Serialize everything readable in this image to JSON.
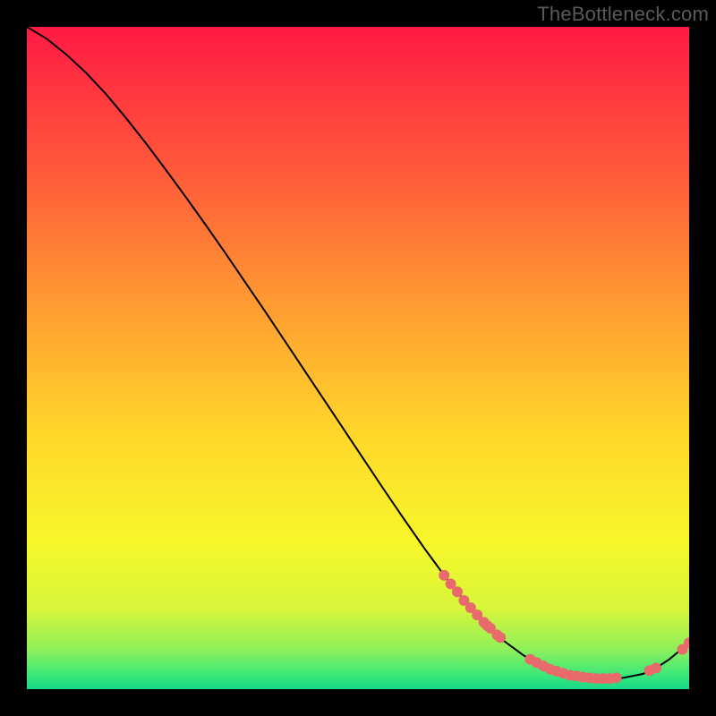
{
  "watermark": "TheBottleneck.com",
  "chart_data": {
    "type": "line",
    "title": "",
    "xlabel": "",
    "ylabel": "",
    "xlim": [
      0,
      100
    ],
    "ylim": [
      0,
      100
    ],
    "curve": {
      "name": "bottleneck-curve",
      "x": [
        0,
        3,
        6,
        9,
        12,
        15,
        18,
        21,
        24,
        27,
        30,
        33,
        36,
        39,
        42,
        45,
        48,
        51,
        54,
        57,
        60,
        63,
        66,
        69,
        72,
        75,
        78,
        81,
        84,
        87,
        90,
        93,
        95,
        97,
        100
      ],
      "y": [
        100,
        98.2,
        95.8,
        93.0,
        89.8,
        86.2,
        82.4,
        78.4,
        74.3,
        70.1,
        65.8,
        61.4,
        57.0,
        52.5,
        48.0,
        43.5,
        39.0,
        34.5,
        30.0,
        25.6,
        21.3,
        17.2,
        13.4,
        10.1,
        7.3,
        5.1,
        3.5,
        2.4,
        1.8,
        1.6,
        1.7,
        2.3,
        3.2,
        4.5,
        7.0
      ]
    },
    "flat_region": {
      "x_start": 75,
      "x_end": 95
    },
    "markers": [
      {
        "name": "cluster-left",
        "points": [
          {
            "x": 63,
            "y": 17.2
          },
          {
            "x": 64,
            "y": 15.9
          },
          {
            "x": 65,
            "y": 14.7
          },
          {
            "x": 66,
            "y": 13.4
          },
          {
            "x": 67,
            "y": 12.3
          },
          {
            "x": 68,
            "y": 11.2
          },
          {
            "x": 69,
            "y": 10.1
          },
          {
            "x": 69.5,
            "y": 9.6
          },
          {
            "x": 70,
            "y": 9.2
          },
          {
            "x": 71,
            "y": 8.2
          },
          {
            "x": 71.5,
            "y": 7.8
          }
        ]
      },
      {
        "name": "cluster-bottom",
        "points": [
          {
            "x": 76,
            "y": 4.5
          },
          {
            "x": 77,
            "y": 4.0
          },
          {
            "x": 78,
            "y": 3.5
          },
          {
            "x": 79,
            "y": 3.0
          },
          {
            "x": 80,
            "y": 2.7
          },
          {
            "x": 81,
            "y": 2.4
          },
          {
            "x": 82,
            "y": 2.1
          },
          {
            "x": 83,
            "y": 2.0
          },
          {
            "x": 84,
            "y": 1.8
          },
          {
            "x": 85,
            "y": 1.7
          },
          {
            "x": 86,
            "y": 1.6
          },
          {
            "x": 87,
            "y": 1.6
          },
          {
            "x": 88,
            "y": 1.6
          },
          {
            "x": 89,
            "y": 1.7
          }
        ]
      },
      {
        "name": "cluster-right",
        "points": [
          {
            "x": 94,
            "y": 2.8
          },
          {
            "x": 95,
            "y": 3.2
          },
          {
            "x": 99,
            "y": 6.0
          },
          {
            "x": 100,
            "y": 7.0
          }
        ]
      }
    ],
    "gradient_stops": [
      {
        "offset": 0.0,
        "color": "#ff1a44"
      },
      {
        "offset": 0.22,
        "color": "#ff5a3a"
      },
      {
        "offset": 0.45,
        "color": "#ffa530"
      },
      {
        "offset": 0.62,
        "color": "#ffd82a"
      },
      {
        "offset": 0.78,
        "color": "#f7f72a"
      },
      {
        "offset": 0.88,
        "color": "#d6f53a"
      },
      {
        "offset": 0.94,
        "color": "#8ef05a"
      },
      {
        "offset": 0.98,
        "color": "#37e77a"
      },
      {
        "offset": 1.0,
        "color": "#18d98a"
      }
    ],
    "marker_color": "#e86a6a",
    "curve_color": "#000000"
  }
}
